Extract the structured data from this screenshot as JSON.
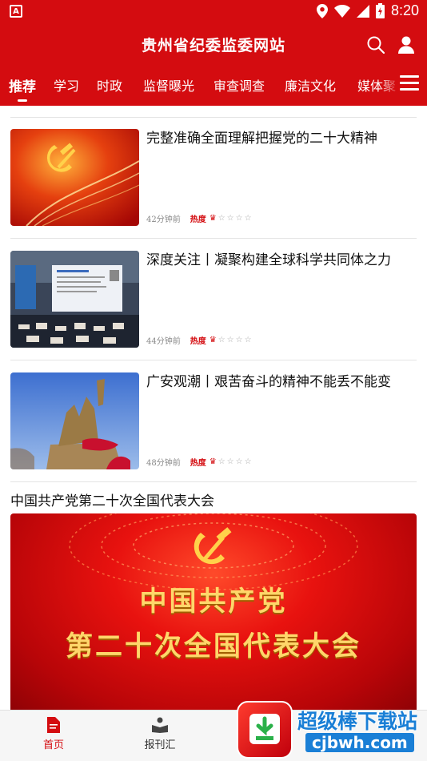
{
  "status_bar": {
    "time": "8:20",
    "left_icon": "A"
  },
  "header": {
    "title": "贵州省纪委监委网站"
  },
  "tabs": [
    {
      "label": "推荐"
    },
    {
      "label": "学习"
    },
    {
      "label": "时政"
    },
    {
      "label": "监督曝光"
    },
    {
      "label": "审查调查"
    },
    {
      "label": "廉洁文化"
    },
    {
      "label": "媒体聚"
    }
  ],
  "news": [
    {
      "title": "完整准确全面理解把握党的二十大精神",
      "time": "42分钟前",
      "hot_label": "热度",
      "hot_level": 1,
      "hot_max": 5
    },
    {
      "title": "深度关注丨凝聚构建全球科学共同体之力",
      "time": "44分钟前",
      "hot_label": "热度",
      "hot_level": 1,
      "hot_max": 5
    },
    {
      "title": "广安观潮丨艰苦奋斗的精神不能丢不能变",
      "time": "48分钟前",
      "hot_label": "热度",
      "hot_level": 1,
      "hot_max": 5
    }
  ],
  "section": {
    "title": "中国共产党第二十次全国代表大会"
  },
  "banner": {
    "line1": "中国共产党",
    "line2": "第二十次全国代表大会"
  },
  "bottom_nav": [
    {
      "label": "首页"
    },
    {
      "label": "报刊汇"
    }
  ],
  "watermark": {
    "text": "超级棒下载站",
    "url": "cjbwh.com"
  },
  "colors": {
    "primary": "#d40c10",
    "text": "#111111",
    "muted": "#888888"
  }
}
